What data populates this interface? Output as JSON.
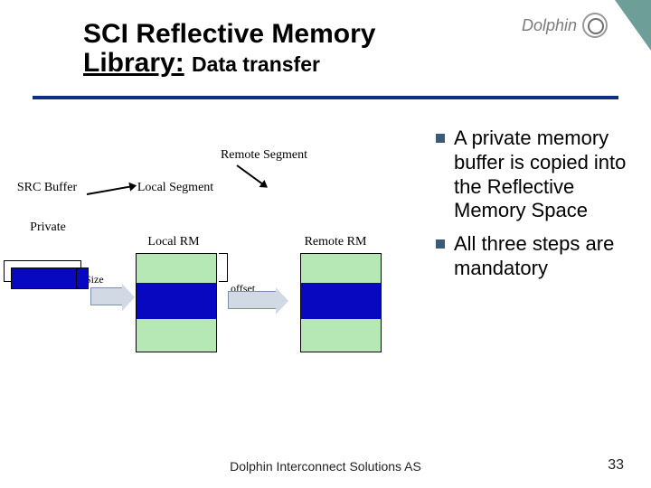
{
  "title_line1": "SCI Reflective Memory",
  "title_line2": "Library:",
  "subtitle": "Data transfer",
  "logo_text": "Dolphin",
  "diagram": {
    "src_buffer": "SRC Buffer",
    "private": "Private",
    "local_segment": "Local Segment",
    "local_rm": "Local RM",
    "remote_segment": "Remote Segment",
    "remote_rm": "Remote RM",
    "size": "Size",
    "offset": "offset"
  },
  "bullets": [
    "A private memory buffer is copied into the Reflective Memory Space",
    "All three steps are mandatory"
  ],
  "footer": "Dolphin Interconnect Solutions AS",
  "slide_number": "33",
  "colors": {
    "rule": "#0c2f85",
    "bullet_square": "#3a5a78",
    "block_blue": "#0808c0",
    "block_green": "#b6e8b6",
    "accent": "#6d9f98"
  }
}
